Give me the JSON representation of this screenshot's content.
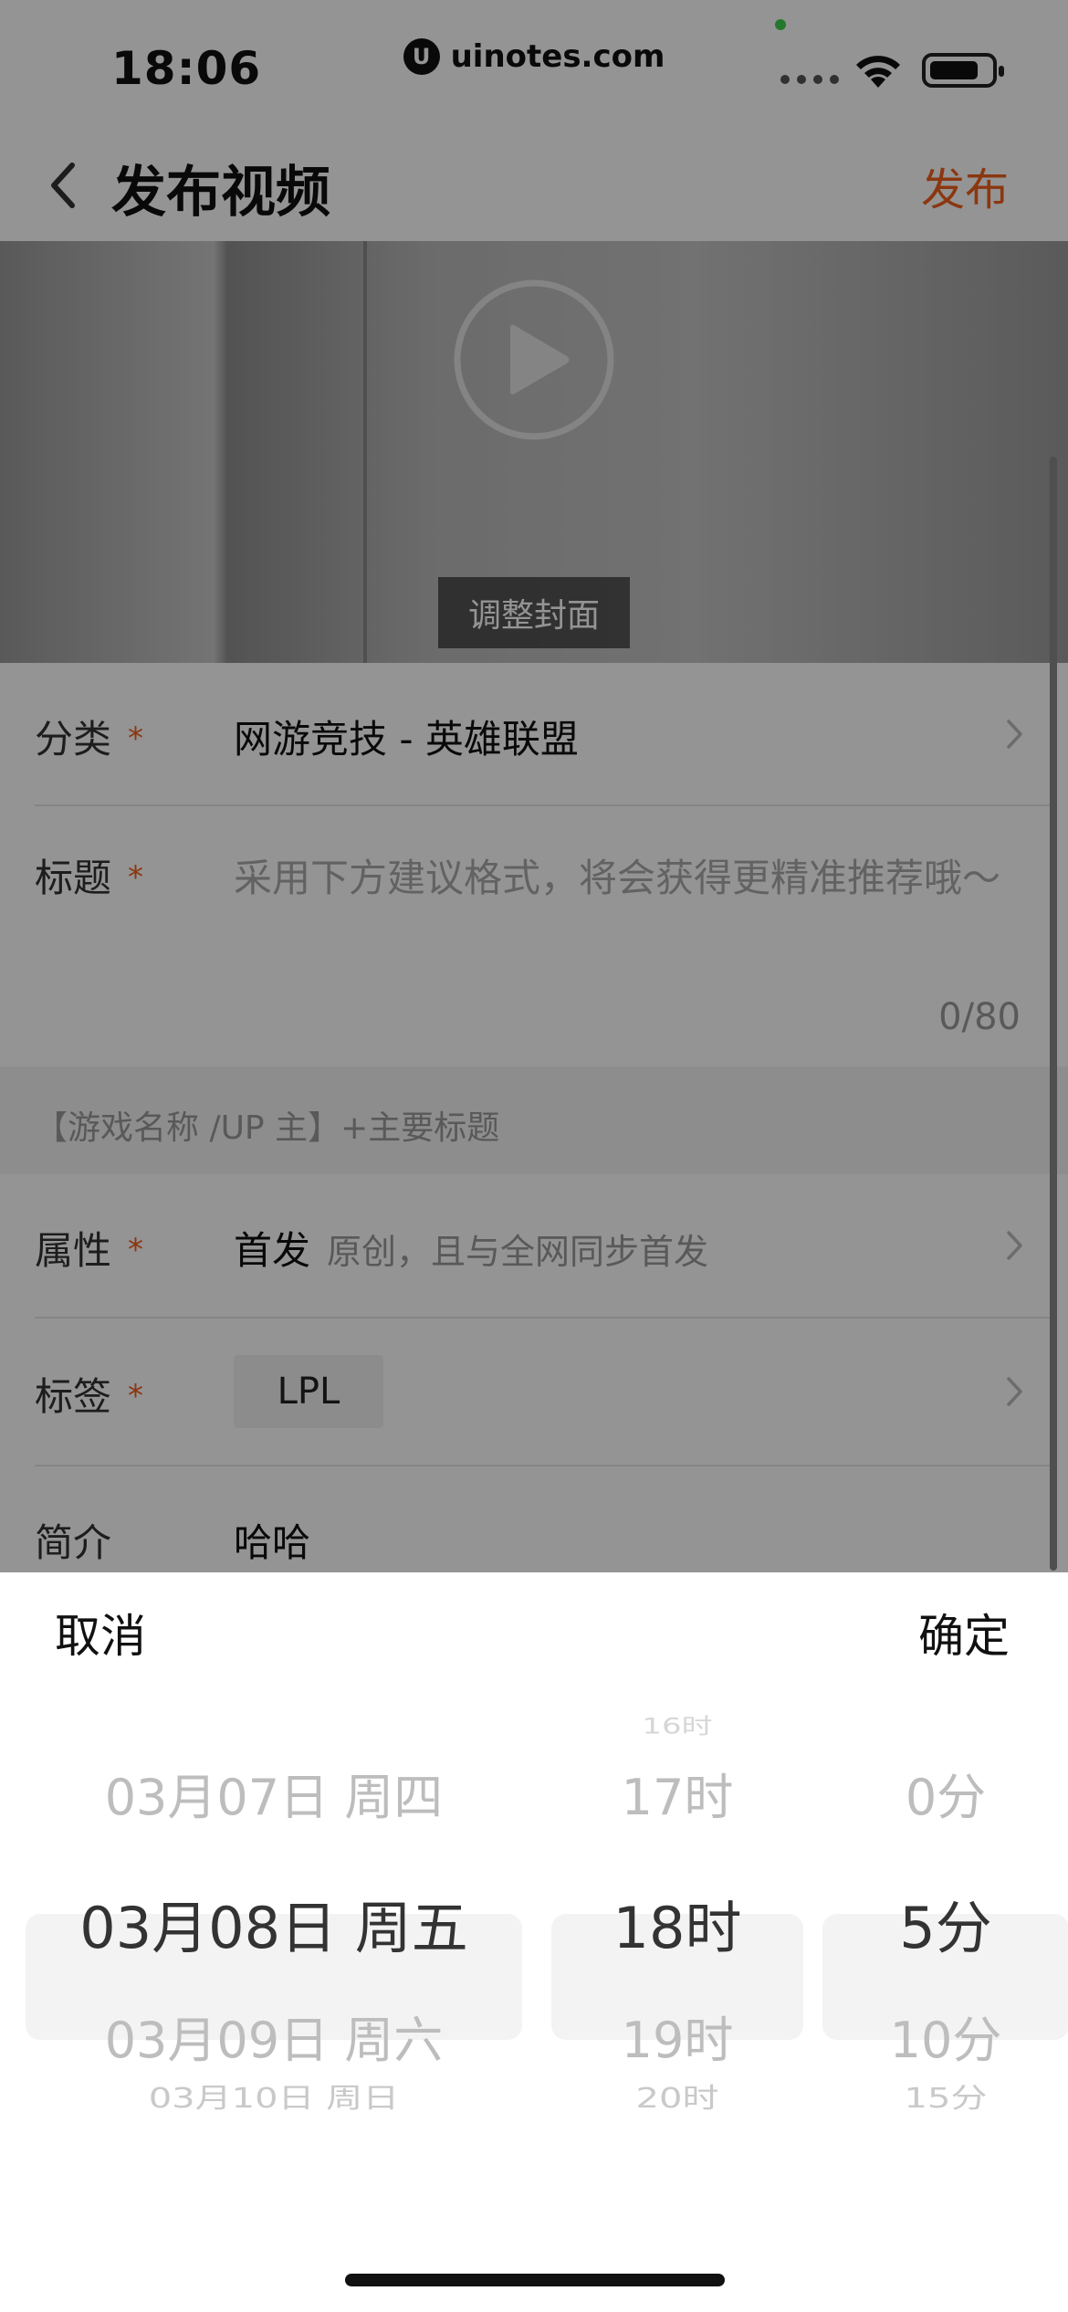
{
  "status_bar": {
    "time": "18:06",
    "url": "uinotes.com",
    "logo_letter": "U"
  },
  "navbar": {
    "title": "发布视频",
    "publish_label": "发布"
  },
  "video": {
    "cover_button_label": "调整封面"
  },
  "form": {
    "category": {
      "label": "分类",
      "required_mark": "*",
      "value": "网游竞技 - 英雄联盟"
    },
    "title": {
      "label": "标题",
      "required_mark": "*",
      "placeholder": "采用下方建议格式，将会获得更精准推荐哦～",
      "counter": "0/80"
    },
    "format_hint": "【游戏名称 /UP 主】+主要标题",
    "attribute": {
      "label": "属性",
      "required_mark": "*",
      "value": "首发",
      "hint": "原创，且与全网同步首发"
    },
    "tags": {
      "label": "标签",
      "required_mark": "*",
      "items": [
        "LPL"
      ]
    },
    "intro": {
      "label": "简介",
      "value": "哈哈"
    }
  },
  "picker": {
    "cancel_label": "取消",
    "confirm_label": "确定",
    "date": {
      "above": "03月07日 周四",
      "selected": "03月08日 周五",
      "below": "03月09日 周六",
      "below2": "03月10日 周日"
    },
    "hour": {
      "above2": "16时",
      "above": "17时",
      "selected": "18时",
      "below": "19时",
      "below2": "20时"
    },
    "minute": {
      "above": "0分",
      "selected": "5分",
      "below": "10分",
      "below2": "15分"
    }
  },
  "colors": {
    "accent": "#f0601e",
    "overlay": "rgba(0,0,0,0.42)"
  }
}
